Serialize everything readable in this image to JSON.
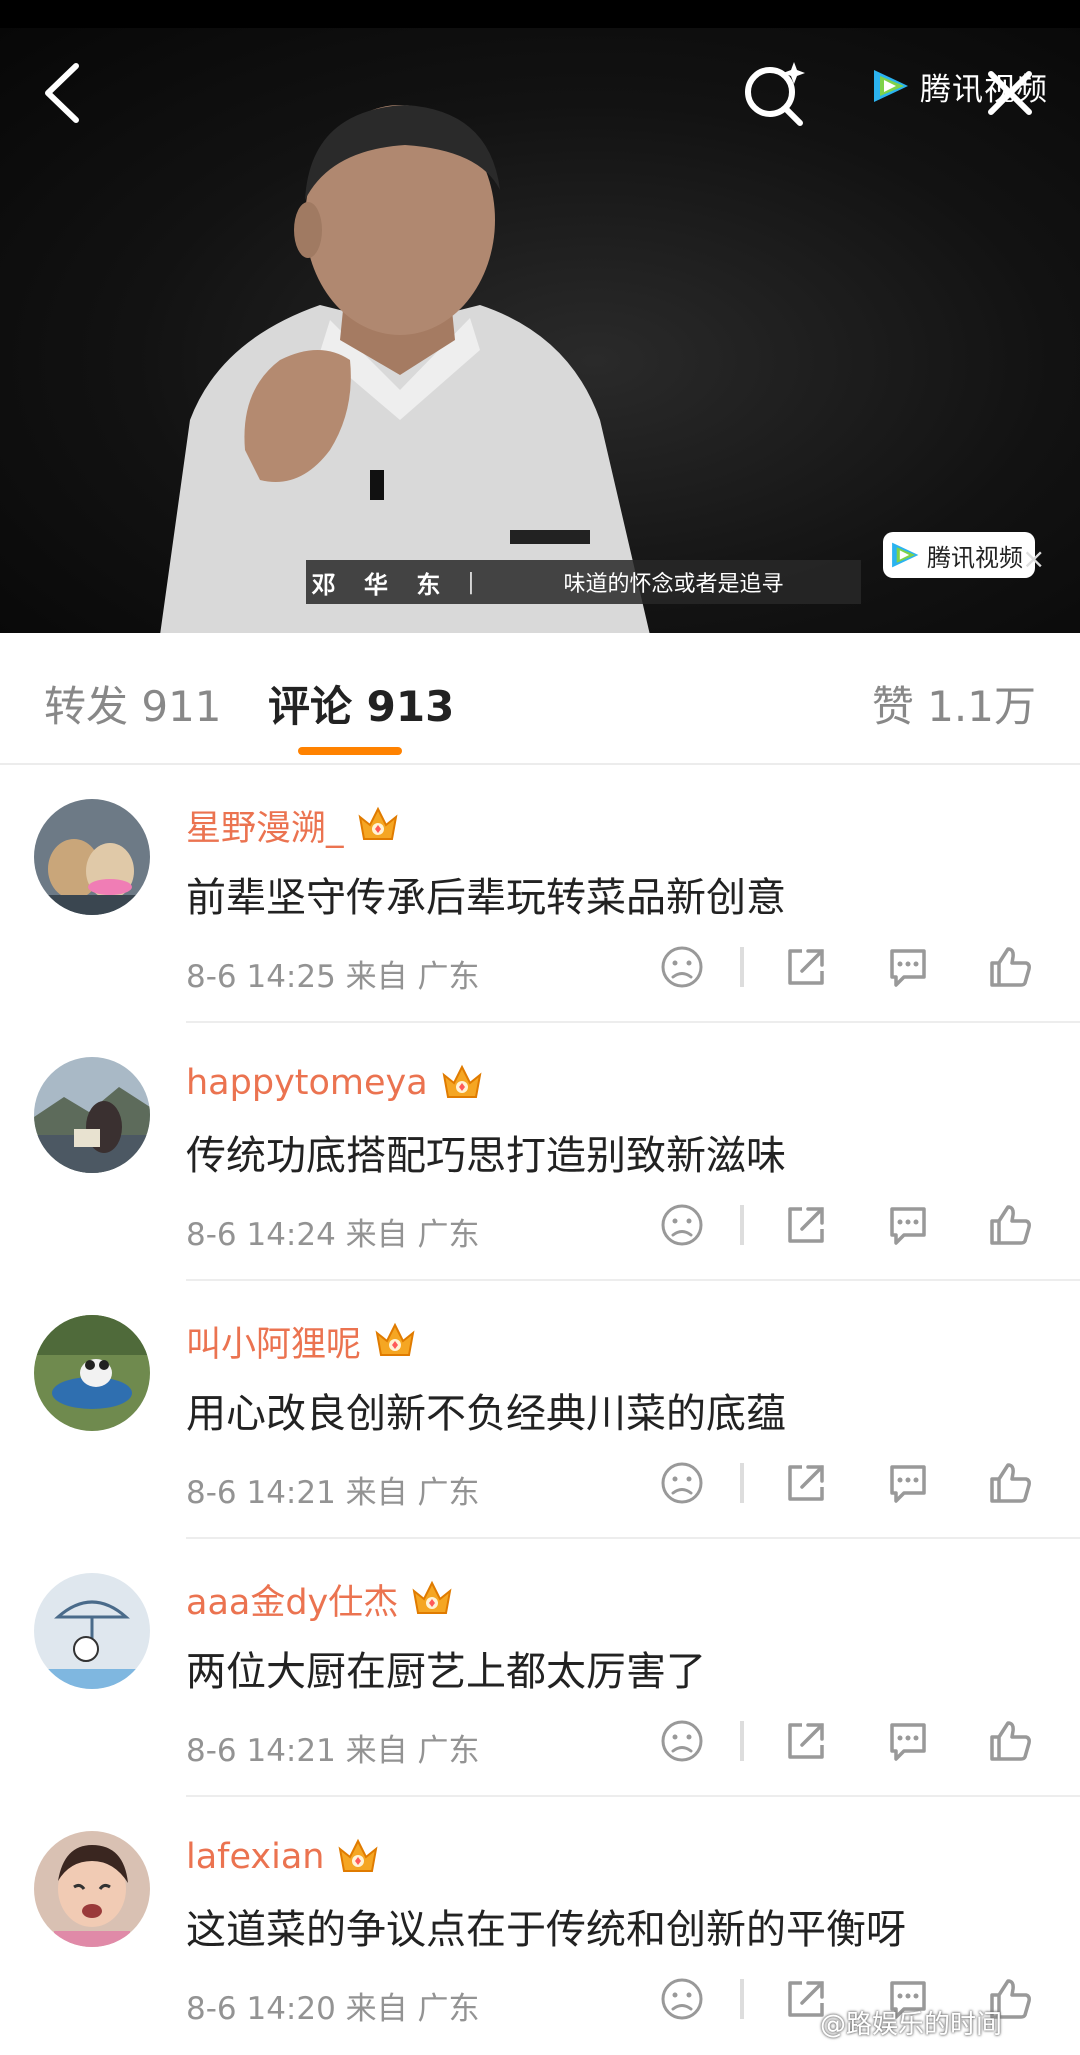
{
  "video": {
    "subtitle_name": "邓 华 东",
    "subtitle_separator": "|",
    "subtitle_line": "味道的怀念或者是追寻",
    "watermark_top": "腾讯视频",
    "watermark_bottom": "腾讯视频",
    "icons": {
      "back": "chevron-left-icon",
      "search": "sparkle-search-icon",
      "close": "close-icon"
    }
  },
  "tabs": {
    "repost": "转发 911",
    "comments": "评论 913",
    "likes": "赞 1.1万",
    "active": "comments"
  },
  "comments": [
    {
      "username": "星野漫溯_",
      "text": "前辈坚守传承后辈玩转菜品新创意",
      "meta": "8-6 14:25  来自 广东"
    },
    {
      "username": "happytomeya",
      "text": "传统功底搭配巧思打造别致新滋味",
      "meta": "8-6 14:24  来自 广东"
    },
    {
      "username": "叫小阿狸呢",
      "text": "用心改良创新不负经典川菜的底蕴",
      "meta": "8-6 14:21  来自 广东"
    },
    {
      "username": "aaa金dy仕杰",
      "text": "两位大厨在厨艺上都太厉害了",
      "meta": "8-6 14:21  来自 广东"
    },
    {
      "username": "lafexian",
      "text": "这道菜的争议点在于传统和创新的平衡呀",
      "meta": "8-6 14:20  来自 广东"
    }
  ],
  "footer_watermark": "@路娱乐的时间",
  "colors": {
    "accent": "#ff8200",
    "username": "#eb7350",
    "meta": "#939393"
  }
}
